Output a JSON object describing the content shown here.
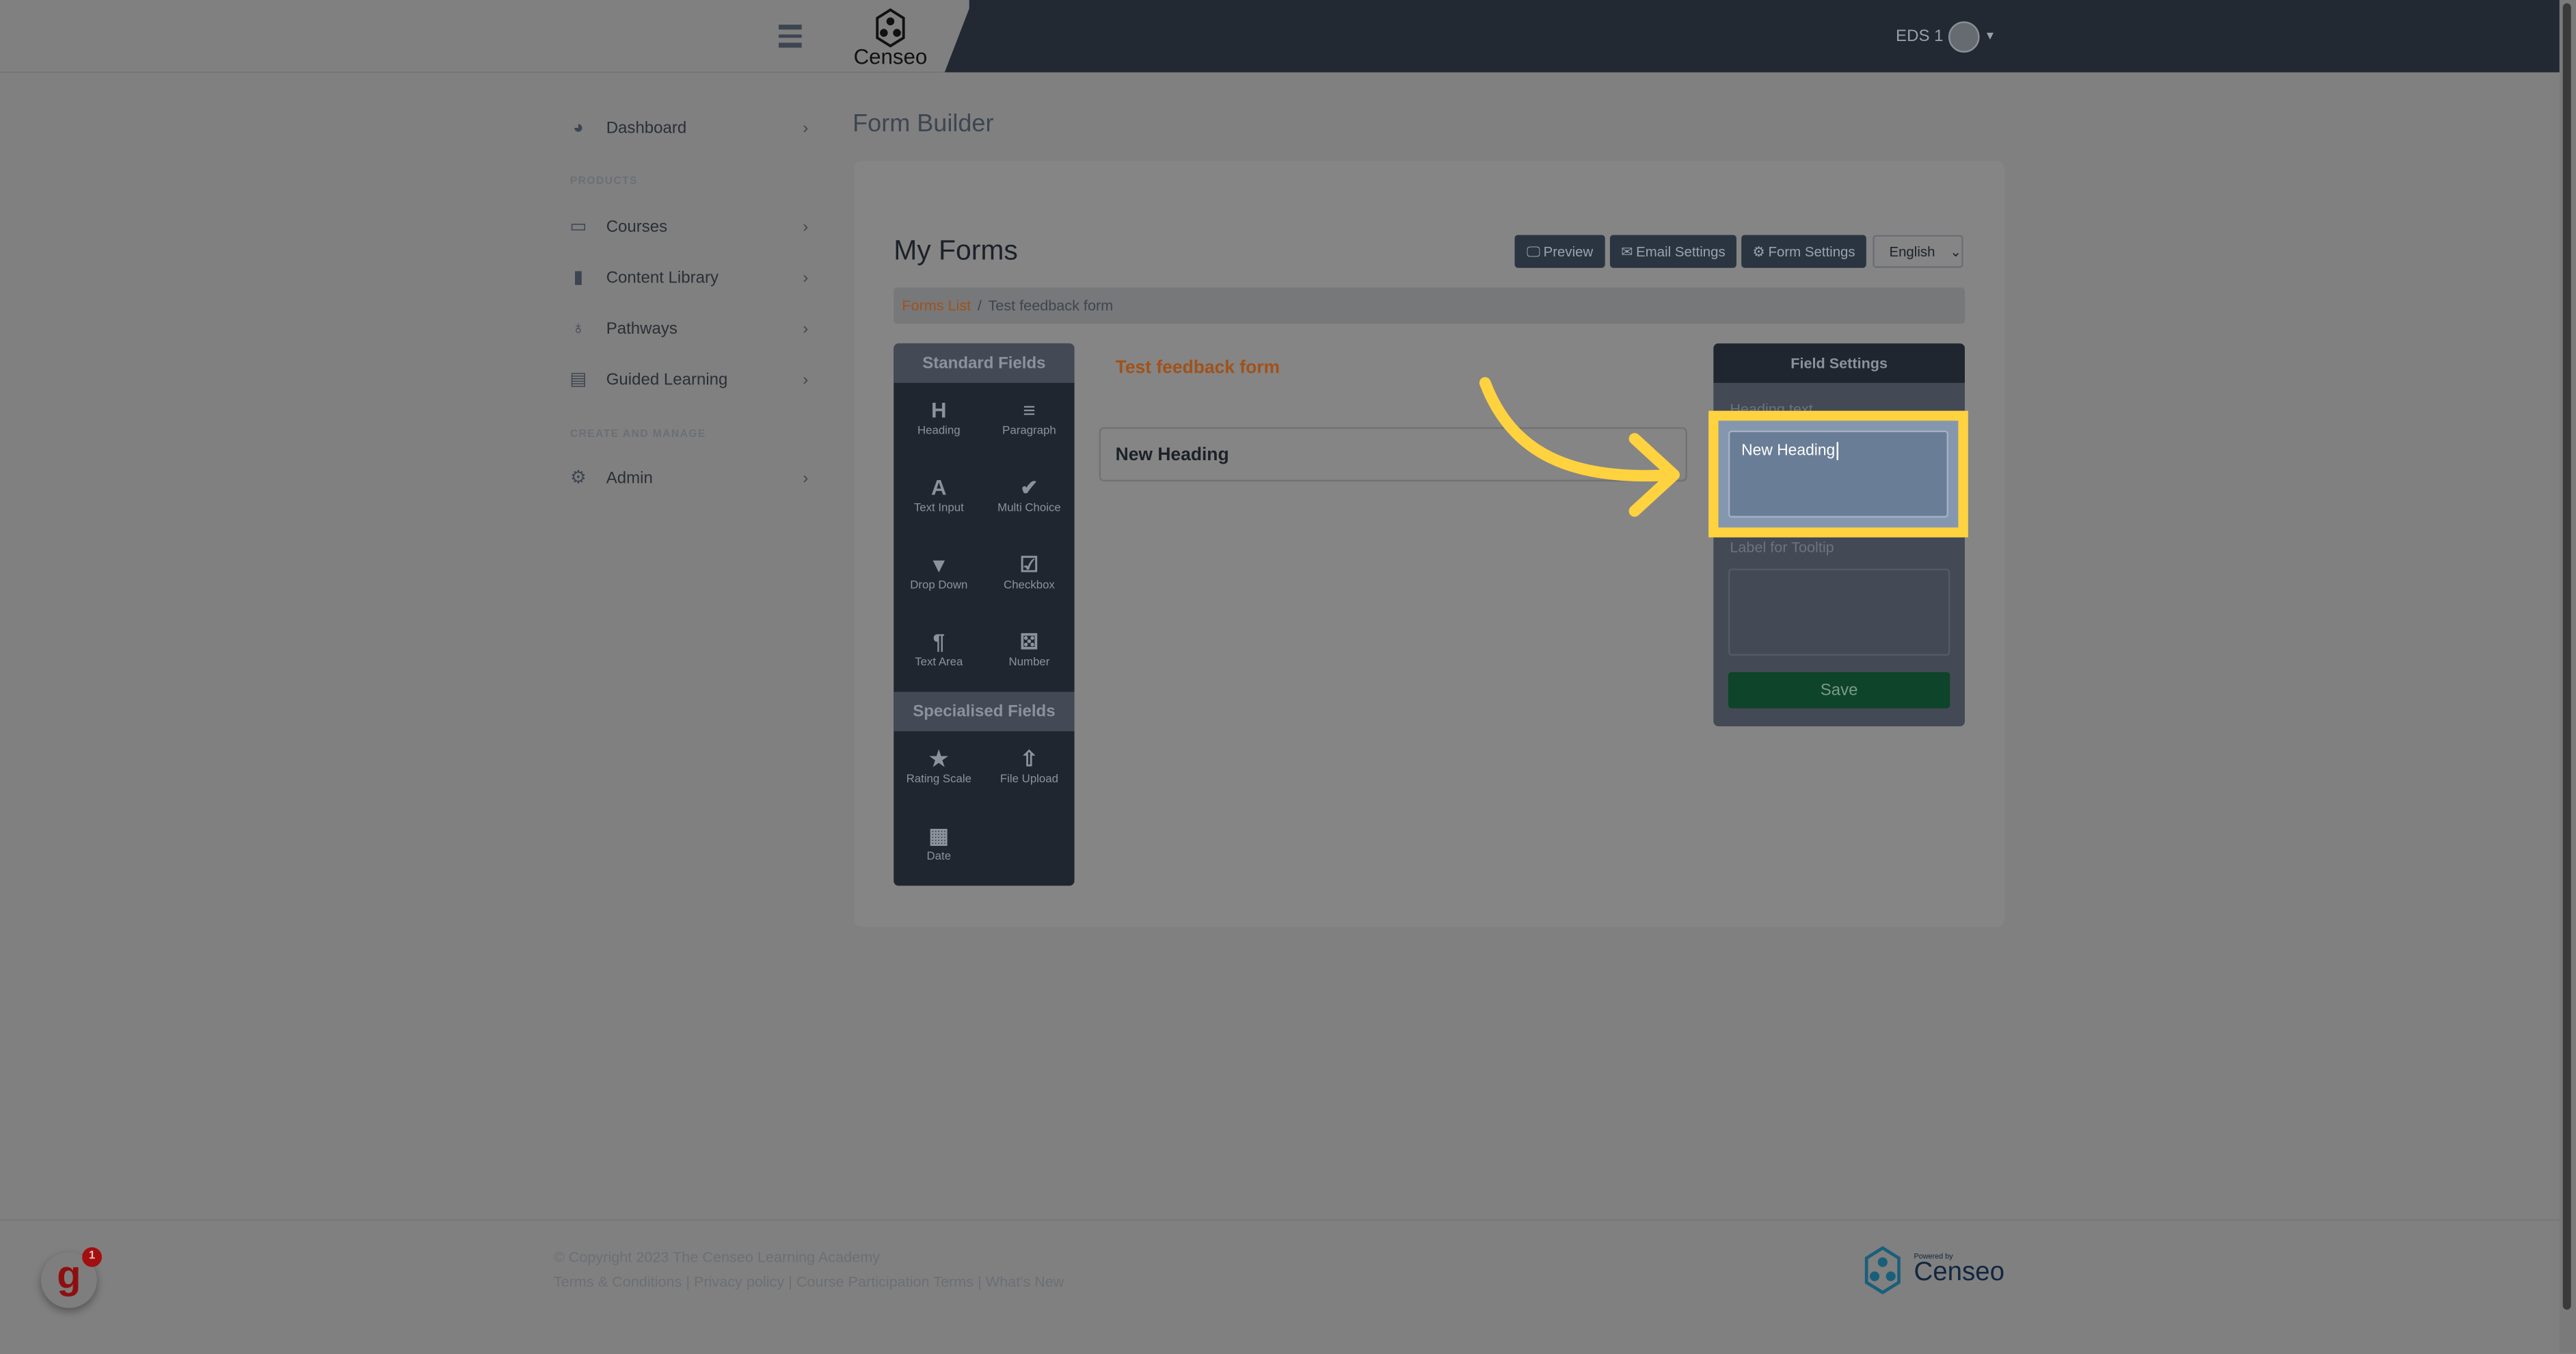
{
  "header": {
    "brand": "Censeo",
    "user": "EDS 1"
  },
  "sidebar": {
    "items": [
      {
        "label": "Dashboard",
        "icon": "dashboard-icon"
      }
    ],
    "sections": [
      {
        "title": "PRODUCTS",
        "items": [
          {
            "label": "Courses",
            "icon": "courses-icon"
          },
          {
            "label": "Content Library",
            "icon": "book-icon"
          },
          {
            "label": "Pathways",
            "icon": "award-icon"
          },
          {
            "label": "Guided Learning",
            "icon": "clipboard-icon"
          }
        ]
      },
      {
        "title": "CREATE AND MANAGE",
        "items": [
          {
            "label": "Admin",
            "icon": "gear-icon"
          }
        ]
      }
    ]
  },
  "page": {
    "title": "Form Builder",
    "heading": "My Forms"
  },
  "toolbar": {
    "preview": "Preview",
    "email_settings": "Email Settings",
    "form_settings": "Form Settings",
    "language": "English"
  },
  "breadcrumb": {
    "link": "Forms List",
    "current": "Test feedback form"
  },
  "fields": {
    "standard_title": "Standard Fields",
    "standard": [
      {
        "label": "Heading",
        "glyph": "H"
      },
      {
        "label": "Paragraph",
        "glyph": "≡"
      },
      {
        "label": "Text Input",
        "glyph": "A"
      },
      {
        "label": "Multi Choice",
        "glyph": "✔"
      },
      {
        "label": "Drop Down",
        "glyph": "▾"
      },
      {
        "label": "Checkbox",
        "glyph": "☑"
      },
      {
        "label": "Text Area",
        "glyph": "¶"
      },
      {
        "label": "Number",
        "glyph": "⚄"
      }
    ],
    "specialised_title": "Specialised Fields",
    "specialised": [
      {
        "label": "Rating Scale",
        "glyph": "★"
      },
      {
        "label": "File Upload",
        "glyph": "⇧"
      },
      {
        "label": "Date",
        "glyph": "▦"
      }
    ]
  },
  "form": {
    "name": "Test feedback form",
    "heading_field": "New Heading"
  },
  "field_settings": {
    "title": "Field Settings",
    "heading_label": "Heading text",
    "heading_value": "New Heading",
    "tooltip_label": "Label for Tooltip",
    "tooltip_value": "",
    "save": "Save"
  },
  "footer": {
    "copyright": "© Copyright 2023 The Censeo Learning Academy",
    "links": [
      "Terms & Conditions",
      "Privacy policy",
      "Course Participation Terms",
      "What's New"
    ],
    "powered_by": "Powered by",
    "brand": "Censeo",
    "badge_count": "1"
  },
  "colors": {
    "highlight": "#ffd23f",
    "accent": "#a0521a",
    "save": "#0e442a",
    "header": "#222933"
  }
}
